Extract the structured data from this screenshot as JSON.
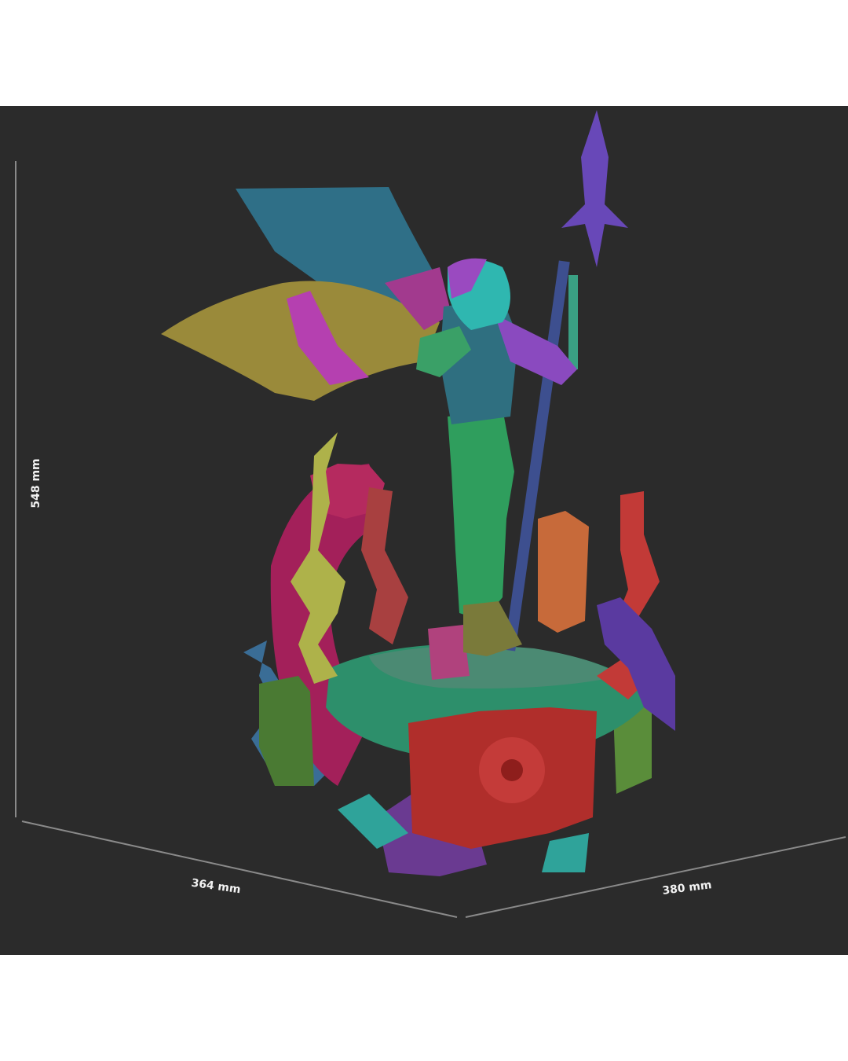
{
  "dimensions": {
    "height": "548 mm",
    "depth": "364 mm",
    "width": "380 mm"
  },
  "colors": {
    "background": "#2b2b2b",
    "border": "#ffffff",
    "dimension_line": "#8a8a8a"
  }
}
